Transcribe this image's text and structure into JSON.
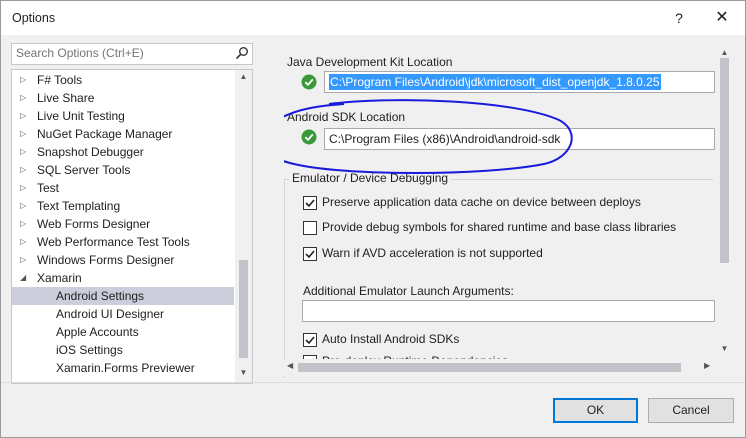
{
  "window": {
    "title": "Options",
    "help_glyph": "?",
    "close_glyph": "✕"
  },
  "search": {
    "placeholder": "Search Options (Ctrl+E)"
  },
  "tree": {
    "items": [
      {
        "label": "F# Tools",
        "expanded": false,
        "child": false,
        "selected": false
      },
      {
        "label": "Live Share",
        "expanded": false,
        "child": false,
        "selected": false
      },
      {
        "label": "Live Unit Testing",
        "expanded": false,
        "child": false,
        "selected": false
      },
      {
        "label": "NuGet Package Manager",
        "expanded": false,
        "child": false,
        "selected": false
      },
      {
        "label": "Snapshot Debugger",
        "expanded": false,
        "child": false,
        "selected": false
      },
      {
        "label": "SQL Server Tools",
        "expanded": false,
        "child": false,
        "selected": false
      },
      {
        "label": "Test",
        "expanded": false,
        "child": false,
        "selected": false
      },
      {
        "label": "Text Templating",
        "expanded": false,
        "child": false,
        "selected": false
      },
      {
        "label": "Web Forms Designer",
        "expanded": false,
        "child": false,
        "selected": false
      },
      {
        "label": "Web Performance Test Tools",
        "expanded": false,
        "child": false,
        "selected": false
      },
      {
        "label": "Windows Forms Designer",
        "expanded": false,
        "child": false,
        "selected": false
      },
      {
        "label": "Xamarin",
        "expanded": true,
        "child": false,
        "selected": false
      },
      {
        "label": "Android Settings",
        "expanded": null,
        "child": true,
        "selected": true
      },
      {
        "label": "Android UI Designer",
        "expanded": null,
        "child": true,
        "selected": false
      },
      {
        "label": "Apple Accounts",
        "expanded": null,
        "child": true,
        "selected": false
      },
      {
        "label": "iOS Settings",
        "expanded": null,
        "child": true,
        "selected": false
      },
      {
        "label": "Xamarin.Forms Previewer",
        "expanded": null,
        "child": true,
        "selected": false
      }
    ]
  },
  "settings": {
    "jdk_label": "Java Development Kit Location",
    "jdk_path": "C:\\Program Files\\Android\\jdk\\microsoft_dist_openjdk_1.8.0.25",
    "sdk_label": "Android SDK Location",
    "sdk_path": "C:\\Program Files (x86)\\Android\\android-sdk",
    "emulator_group": "Emulator / Device Debugging",
    "checkboxes": [
      {
        "label": "Preserve application data cache on device between deploys",
        "checked": true
      },
      {
        "label": "Provide debug symbols for shared runtime and base class libraries",
        "checked": false
      },
      {
        "label": "Warn if AVD acceleration is not supported",
        "checked": true
      }
    ],
    "launch_args_label": "Additional Emulator Launch Arguments:",
    "launch_args_value": "",
    "auto_install_label": "Auto Install Android SDKs",
    "auto_install_checked": true,
    "predeploy_label": "Pre-deploy Runtime Dependencies",
    "predeploy_checked": true
  },
  "buttons": {
    "ok": "OK",
    "cancel": "Cancel"
  },
  "colors": {
    "selection": "#cccedb",
    "highlight": "#3399ff",
    "annotation": "#1a1adc",
    "ok_green": "#3a9a3a",
    "ok_border": "#0078d7"
  }
}
